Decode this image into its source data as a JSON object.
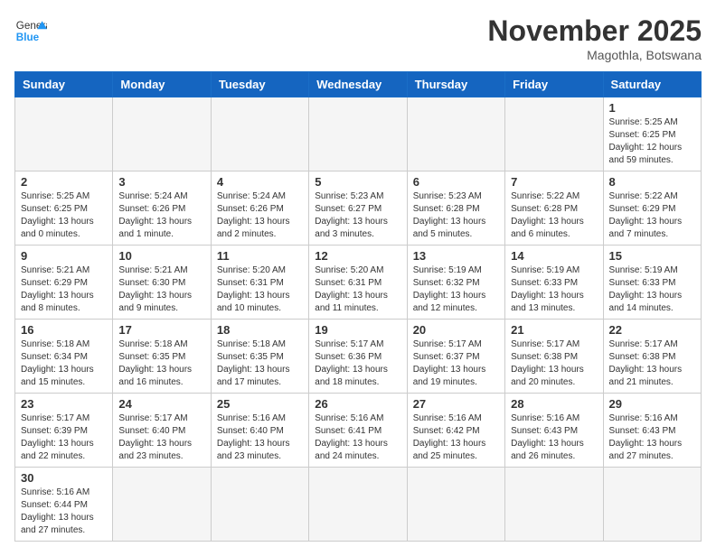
{
  "header": {
    "logo_general": "General",
    "logo_blue": "Blue",
    "month_title": "November 2025",
    "location": "Magothla, Botswana"
  },
  "days_of_week": [
    "Sunday",
    "Monday",
    "Tuesday",
    "Wednesday",
    "Thursday",
    "Friday",
    "Saturday"
  ],
  "weeks": [
    [
      {
        "day": "",
        "info": ""
      },
      {
        "day": "",
        "info": ""
      },
      {
        "day": "",
        "info": ""
      },
      {
        "day": "",
        "info": ""
      },
      {
        "day": "",
        "info": ""
      },
      {
        "day": "",
        "info": ""
      },
      {
        "day": "1",
        "info": "Sunrise: 5:25 AM\nSunset: 6:25 PM\nDaylight: 12 hours and 59 minutes."
      }
    ],
    [
      {
        "day": "2",
        "info": "Sunrise: 5:25 AM\nSunset: 6:25 PM\nDaylight: 13 hours and 0 minutes."
      },
      {
        "day": "3",
        "info": "Sunrise: 5:24 AM\nSunset: 6:26 PM\nDaylight: 13 hours and 1 minute."
      },
      {
        "day": "4",
        "info": "Sunrise: 5:24 AM\nSunset: 6:26 PM\nDaylight: 13 hours and 2 minutes."
      },
      {
        "day": "5",
        "info": "Sunrise: 5:23 AM\nSunset: 6:27 PM\nDaylight: 13 hours and 3 minutes."
      },
      {
        "day": "6",
        "info": "Sunrise: 5:23 AM\nSunset: 6:28 PM\nDaylight: 13 hours and 5 minutes."
      },
      {
        "day": "7",
        "info": "Sunrise: 5:22 AM\nSunset: 6:28 PM\nDaylight: 13 hours and 6 minutes."
      },
      {
        "day": "8",
        "info": "Sunrise: 5:22 AM\nSunset: 6:29 PM\nDaylight: 13 hours and 7 minutes."
      }
    ],
    [
      {
        "day": "9",
        "info": "Sunrise: 5:21 AM\nSunset: 6:29 PM\nDaylight: 13 hours and 8 minutes."
      },
      {
        "day": "10",
        "info": "Sunrise: 5:21 AM\nSunset: 6:30 PM\nDaylight: 13 hours and 9 minutes."
      },
      {
        "day": "11",
        "info": "Sunrise: 5:20 AM\nSunset: 6:31 PM\nDaylight: 13 hours and 10 minutes."
      },
      {
        "day": "12",
        "info": "Sunrise: 5:20 AM\nSunset: 6:31 PM\nDaylight: 13 hours and 11 minutes."
      },
      {
        "day": "13",
        "info": "Sunrise: 5:19 AM\nSunset: 6:32 PM\nDaylight: 13 hours and 12 minutes."
      },
      {
        "day": "14",
        "info": "Sunrise: 5:19 AM\nSunset: 6:33 PM\nDaylight: 13 hours and 13 minutes."
      },
      {
        "day": "15",
        "info": "Sunrise: 5:19 AM\nSunset: 6:33 PM\nDaylight: 13 hours and 14 minutes."
      }
    ],
    [
      {
        "day": "16",
        "info": "Sunrise: 5:18 AM\nSunset: 6:34 PM\nDaylight: 13 hours and 15 minutes."
      },
      {
        "day": "17",
        "info": "Sunrise: 5:18 AM\nSunset: 6:35 PM\nDaylight: 13 hours and 16 minutes."
      },
      {
        "day": "18",
        "info": "Sunrise: 5:18 AM\nSunset: 6:35 PM\nDaylight: 13 hours and 17 minutes."
      },
      {
        "day": "19",
        "info": "Sunrise: 5:17 AM\nSunset: 6:36 PM\nDaylight: 13 hours and 18 minutes."
      },
      {
        "day": "20",
        "info": "Sunrise: 5:17 AM\nSunset: 6:37 PM\nDaylight: 13 hours and 19 minutes."
      },
      {
        "day": "21",
        "info": "Sunrise: 5:17 AM\nSunset: 6:38 PM\nDaylight: 13 hours and 20 minutes."
      },
      {
        "day": "22",
        "info": "Sunrise: 5:17 AM\nSunset: 6:38 PM\nDaylight: 13 hours and 21 minutes."
      }
    ],
    [
      {
        "day": "23",
        "info": "Sunrise: 5:17 AM\nSunset: 6:39 PM\nDaylight: 13 hours and 22 minutes."
      },
      {
        "day": "24",
        "info": "Sunrise: 5:17 AM\nSunset: 6:40 PM\nDaylight: 13 hours and 23 minutes."
      },
      {
        "day": "25",
        "info": "Sunrise: 5:16 AM\nSunset: 6:40 PM\nDaylight: 13 hours and 23 minutes."
      },
      {
        "day": "26",
        "info": "Sunrise: 5:16 AM\nSunset: 6:41 PM\nDaylight: 13 hours and 24 minutes."
      },
      {
        "day": "27",
        "info": "Sunrise: 5:16 AM\nSunset: 6:42 PM\nDaylight: 13 hours and 25 minutes."
      },
      {
        "day": "28",
        "info": "Sunrise: 5:16 AM\nSunset: 6:43 PM\nDaylight: 13 hours and 26 minutes."
      },
      {
        "day": "29",
        "info": "Sunrise: 5:16 AM\nSunset: 6:43 PM\nDaylight: 13 hours and 27 minutes."
      }
    ],
    [
      {
        "day": "30",
        "info": "Sunrise: 5:16 AM\nSunset: 6:44 PM\nDaylight: 13 hours and 27 minutes."
      },
      {
        "day": "",
        "info": ""
      },
      {
        "day": "",
        "info": ""
      },
      {
        "day": "",
        "info": ""
      },
      {
        "day": "",
        "info": ""
      },
      {
        "day": "",
        "info": ""
      },
      {
        "day": "",
        "info": ""
      }
    ]
  ]
}
